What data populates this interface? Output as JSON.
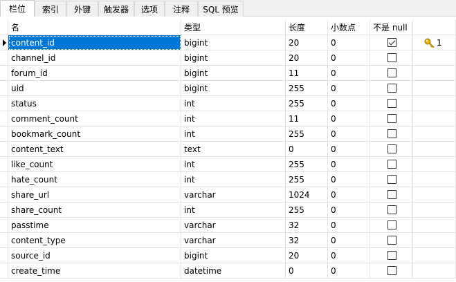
{
  "tabs": [
    "栏位",
    "索引",
    "外键",
    "触发器",
    "选项",
    "注释",
    "SQL 预览"
  ],
  "columns": {
    "name": "名",
    "type": "类型",
    "length": "长度",
    "decimals": "小数点",
    "not_null": "不是 null",
    "key": ""
  },
  "rows": [
    {
      "name": "content_id",
      "type": "bigint",
      "length": "20",
      "decimals": "0",
      "not_null": true,
      "key": "1"
    },
    {
      "name": "channel_id",
      "type": "bigint",
      "length": "20",
      "decimals": "0",
      "not_null": false,
      "key": ""
    },
    {
      "name": "forum_id",
      "type": "bigint",
      "length": "11",
      "decimals": "0",
      "not_null": false,
      "key": ""
    },
    {
      "name": "uid",
      "type": "bigint",
      "length": "255",
      "decimals": "0",
      "not_null": false,
      "key": ""
    },
    {
      "name": "status",
      "type": "int",
      "length": "255",
      "decimals": "0",
      "not_null": false,
      "key": ""
    },
    {
      "name": "comment_count",
      "type": "int",
      "length": "11",
      "decimals": "0",
      "not_null": false,
      "key": ""
    },
    {
      "name": "bookmark_count",
      "type": "int",
      "length": "255",
      "decimals": "0",
      "not_null": false,
      "key": ""
    },
    {
      "name": "content_text",
      "type": "text",
      "length": "0",
      "decimals": "0",
      "not_null": false,
      "key": ""
    },
    {
      "name": "like_count",
      "type": "int",
      "length": "255",
      "decimals": "0",
      "not_null": false,
      "key": ""
    },
    {
      "name": "hate_count",
      "type": "int",
      "length": "255",
      "decimals": "0",
      "not_null": false,
      "key": ""
    },
    {
      "name": "share_url",
      "type": "varchar",
      "length": "1024",
      "decimals": "0",
      "not_null": false,
      "key": ""
    },
    {
      "name": "share_count",
      "type": "int",
      "length": "255",
      "decimals": "0",
      "not_null": false,
      "key": ""
    },
    {
      "name": "passtime",
      "type": "varchar",
      "length": "32",
      "decimals": "0",
      "not_null": false,
      "key": ""
    },
    {
      "name": "content_type",
      "type": "varchar",
      "length": "32",
      "decimals": "0",
      "not_null": false,
      "key": ""
    },
    {
      "name": "source_id",
      "type": "bigint",
      "length": "20",
      "decimals": "0",
      "not_null": false,
      "key": ""
    },
    {
      "name": "create_time",
      "type": "datetime",
      "length": "0",
      "decimals": "0",
      "not_null": false,
      "key": ""
    }
  ],
  "selected_row": 0,
  "colors": {
    "selection": "#0078d7",
    "key_icon": "#e8b500"
  },
  "icons": {
    "key": "key-icon",
    "current_row": "row-pointer-icon"
  }
}
